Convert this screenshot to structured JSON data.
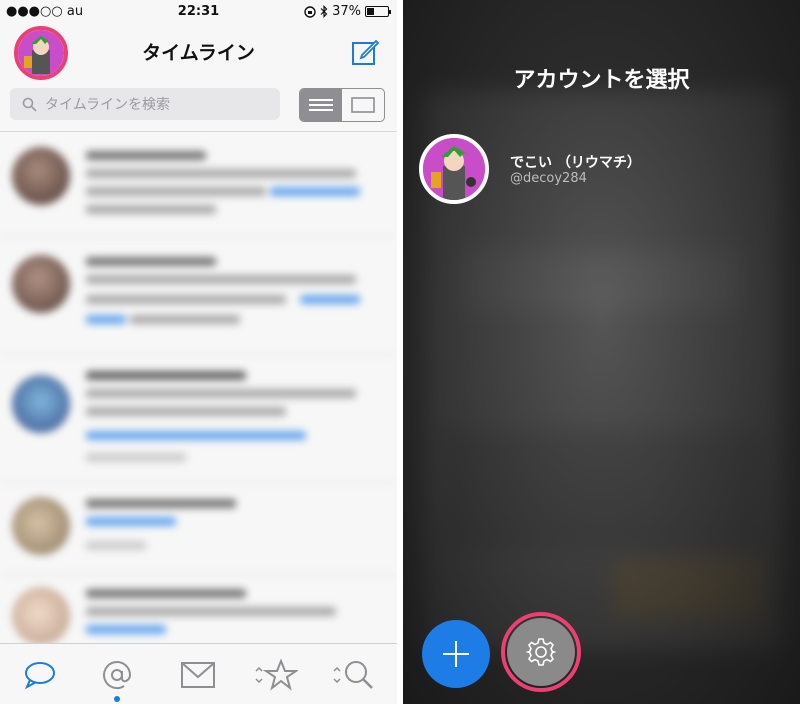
{
  "status": {
    "carrier": "●●●○○ au",
    "time": "22:31",
    "battery": "37%",
    "battery_level": 0.37
  },
  "timeline": {
    "title": "タイムライン",
    "search_placeholder": "タイムラインを検索"
  },
  "tabs": [
    {
      "icon": "speech-bubble-icon",
      "active": true
    },
    {
      "icon": "at-sign-icon",
      "active": false,
      "has_dot": true
    },
    {
      "icon": "mail-icon",
      "active": false
    },
    {
      "icon": "star-icon",
      "active": false
    },
    {
      "icon": "search-icon",
      "active": false
    }
  ],
  "account_panel": {
    "title": "アカウントを選択",
    "accounts": [
      {
        "name": "でこい （リウマチ）",
        "handle": "@decoy284"
      }
    ]
  },
  "colors": {
    "accent": "#1d7ce6",
    "highlight_ring": "#ee3f72",
    "tab_active": "#1a7ae0"
  }
}
